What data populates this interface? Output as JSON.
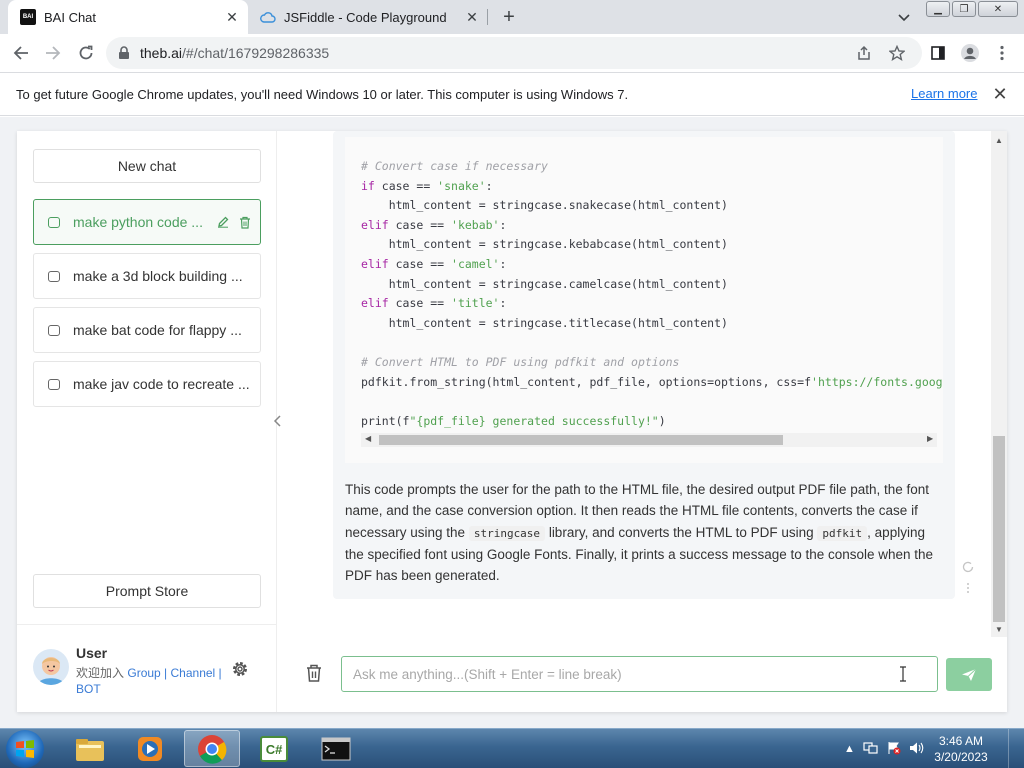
{
  "browser": {
    "tabs": [
      {
        "title": "BAI Chat",
        "favicon": "BAI",
        "active": true
      },
      {
        "title": "JSFiddle - Code Playground",
        "active": false
      }
    ],
    "url_domain": "theb.ai",
    "url_path": "/#/chat/1679298286335",
    "infobar": {
      "message": "To get future Google Chrome updates, you'll need Windows 10 or later. This computer is using Windows 7.",
      "link": "Learn more"
    }
  },
  "sidebar": {
    "new_chat": "New chat",
    "conversations": [
      {
        "label": "make python code ...",
        "active": true
      },
      {
        "label": "make a 3d block building ...",
        "active": false
      },
      {
        "label": "make bat code for flappy ...",
        "active": false
      },
      {
        "label": "make jav code to recreate ...",
        "active": false
      }
    ],
    "prompt_store": "Prompt Store",
    "user": {
      "name": "User",
      "join_text": "欢迎加入",
      "link_group": "Group",
      "sep1": " | ",
      "link_channel": "Channel",
      "sep2": " | ",
      "link_bot": "BOT"
    }
  },
  "chat": {
    "code_lines": [
      {
        "type": "cm",
        "text": "# Convert case if necessary"
      },
      {
        "type": "mixed",
        "kw": "if",
        "mid": " case == ",
        "st": "'snake'",
        "end": ":"
      },
      {
        "type": "plain",
        "text": "    html_content = stringcase.snakecase(html_content)"
      },
      {
        "type": "mixed",
        "kw": "elif",
        "mid": " case == ",
        "st": "'kebab'",
        "end": ":"
      },
      {
        "type": "plain",
        "text": "    html_content = stringcase.kebabcase(html_content)"
      },
      {
        "type": "mixed",
        "kw": "elif",
        "mid": " case == ",
        "st": "'camel'",
        "end": ":"
      },
      {
        "type": "plain",
        "text": "    html_content = stringcase.camelcase(html_content)"
      },
      {
        "type": "mixed",
        "kw": "elif",
        "mid": " case == ",
        "st": "'title'",
        "end": ":"
      },
      {
        "type": "plain",
        "text": "    html_content = stringcase.titlecase(html_content)"
      },
      {
        "type": "blank",
        "text": ""
      },
      {
        "type": "cm",
        "text": "# Convert HTML to PDF using pdfkit and options"
      },
      {
        "type": "pdf",
        "pre": "pdfkit.from_string(html_content, pdf_file, options=options, css=f",
        "st": "'https://fonts.googlea"
      },
      {
        "type": "blank",
        "text": ""
      },
      {
        "type": "print",
        "pre": "print(f",
        "st": "\"{pdf_file} generated successfully!\"",
        "end": ")"
      }
    ],
    "answer_parts": [
      "This code prompts the user for the path to the HTML file, the desired output PDF file path, the font name, and the case conversion option. It then reads the HTML file contents, converts the case if necessary using the ",
      "stringcase",
      " library, and converts the HTML to PDF using ",
      "pdfkit",
      ", applying the specified font using Google Fonts. Finally, it prints a success message to the console when the PDF has been generated."
    ],
    "input_placeholder": "Ask me anything...(Shift + Enter = line break)"
  },
  "taskbar": {
    "time": "3:46 AM",
    "date": "3/20/2023"
  },
  "colors": {
    "accent_green": "#4b9e5f",
    "send_button": "#8ccfa0",
    "link_blue": "#1a73e8"
  }
}
